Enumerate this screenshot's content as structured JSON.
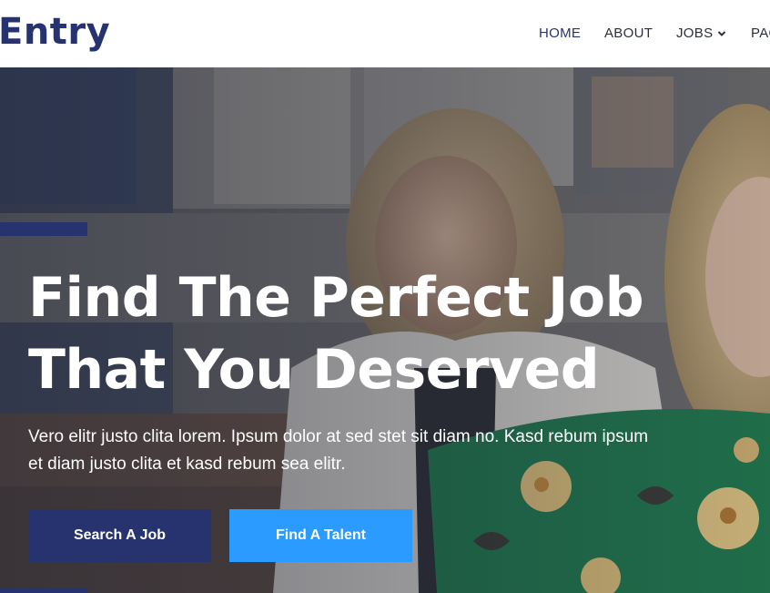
{
  "brand": {
    "name": "Entry"
  },
  "nav": {
    "home": "HOME",
    "about": "ABOUT",
    "jobs": "JOBS",
    "pages": "PAG"
  },
  "hero": {
    "headline_line1": "Find The Perfect Job",
    "headline_line2": "That You Deserved",
    "subtext": "Vero elitr justo clita lorem. Ipsum dolor at sed stet sit diam no. Kasd rebum ipsum et diam justo clita et kasd rebum sea elitr.",
    "buttons": {
      "search": "Search A Job",
      "talent": "Find A Talent"
    }
  },
  "colors": {
    "primary": "#26336f",
    "accent": "#2b9bff",
    "nav_text": "#2b2f3a"
  }
}
